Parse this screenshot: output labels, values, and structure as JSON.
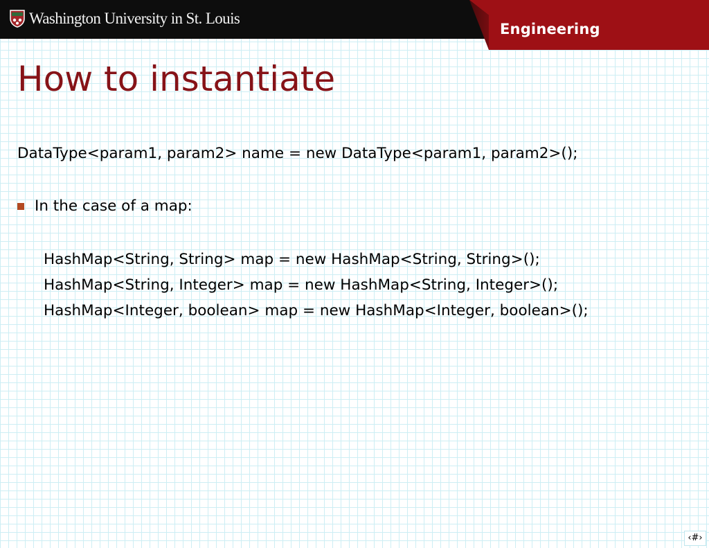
{
  "header": {
    "university_name": "Washington University in St. Louis",
    "section_label": "Engineering"
  },
  "slide": {
    "title": "How to instantiate",
    "syntax_line": "DataType<param1, param2> name = new DataType<param1, param2>();",
    "bullet_text": "In the case of a map:",
    "examples": [
      "HashMap<String, String> map = new HashMap<String, String>();",
      "HashMap<String, Integer> map = new HashMap<String, Integer>();",
      "HashMap<Integer, boolean> map = new HashMap<Integer, boolean>();"
    ],
    "slide_number": "‹#›"
  },
  "colors": {
    "title": "#861318",
    "engineering_tab": "#9e1015",
    "bullet": "#b34a22",
    "grid": "#cdeef4"
  }
}
